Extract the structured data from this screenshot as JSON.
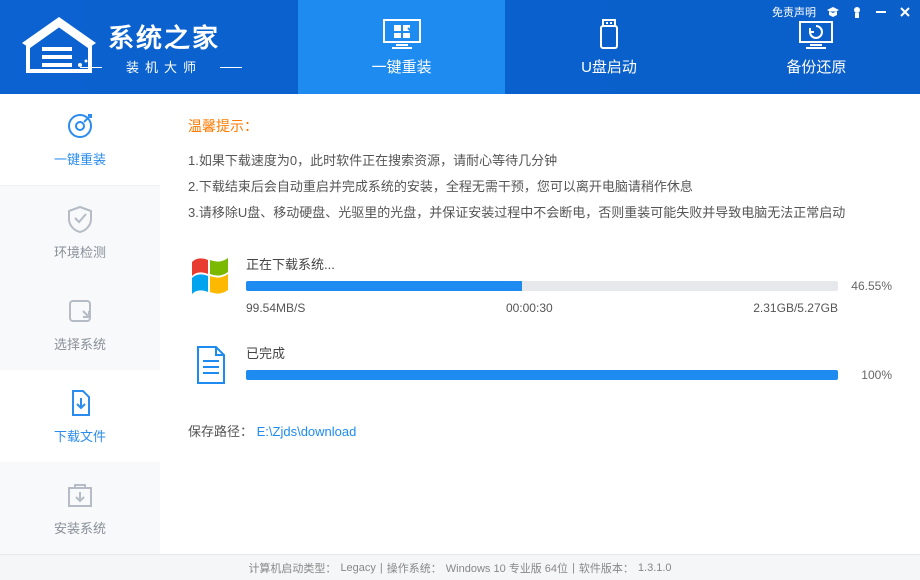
{
  "header": {
    "logo_title": "系统之家",
    "logo_subtitle": "装机大师",
    "tabs": [
      {
        "label": "一键重装"
      },
      {
        "label": "U盘启动"
      },
      {
        "label": "备份还原"
      }
    ],
    "disclaimer": "免责声明"
  },
  "sidebar": {
    "items": [
      {
        "label": "一键重装"
      },
      {
        "label": "环境检测"
      },
      {
        "label": "选择系统"
      },
      {
        "label": "下载文件"
      },
      {
        "label": "安装系统"
      }
    ]
  },
  "tips": {
    "title": "温馨提示：",
    "lines": [
      "1.如果下载速度为0，此时软件正在搜索资源，请耐心等待几分钟",
      "2.下载结束后会自动重启并完成系统的安装，全程无需干预，您可以离开电脑请稍作休息",
      "3.请移除U盘、移动硬盘、光驱里的光盘，并保证安装过程中不会断电，否则重装可能失败并导致电脑无法正常启动"
    ]
  },
  "download1": {
    "label": "正在下载系统...",
    "percent_text": "46.55%",
    "percent": 46.55,
    "speed": "99.54MB/S",
    "elapsed": "00:00:30",
    "size": "2.31GB/5.27GB"
  },
  "download2": {
    "label": "已完成",
    "percent_text": "100%",
    "percent": 100
  },
  "path": {
    "label": "保存路径：",
    "value": "E:\\Zjds\\download"
  },
  "footer": {
    "boot_label": "计算机启动类型：",
    "boot_value": "Legacy",
    "os_label": "操作系统：",
    "os_value": "Windows 10 专业版 64位",
    "ver_label": "软件版本：",
    "ver_value": "1.3.1.0",
    "sep": " | "
  }
}
